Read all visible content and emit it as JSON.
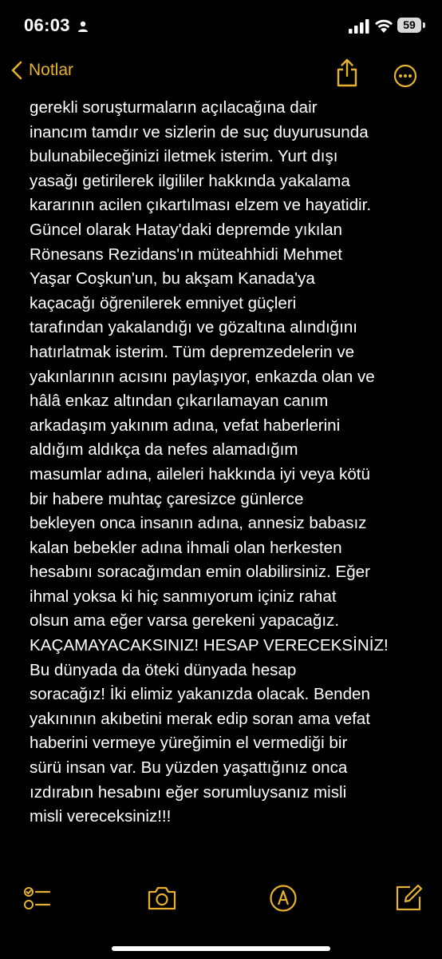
{
  "status_bar": {
    "time": "06:03",
    "battery_level": "59",
    "icons": [
      "person-icon",
      "cellular-signal-icon",
      "wifi-icon",
      "battery-icon"
    ]
  },
  "nav": {
    "back_label": "Notlar",
    "icons": [
      "chevron-left-icon",
      "share-icon",
      "more-icon"
    ]
  },
  "note": {
    "lines": [
      "gerekli soruşturmaların açılacağına dair",
      "inancım tamdır ve sizlerin de suç duyurusunda",
      "bulunabileceğinizi iletmek isterim. Yurt dışı",
      "yasağı getirilerek ilgililer hakkında yakalama",
      "kararının acilen çıkartılması elzem ve hayatidir.",
      "Güncel olarak Hatay'daki depremde yıkılan",
      "Rönesans Rezidans'ın müteahhidi Mehmet",
      "Yaşar Coşkun'un, bu akşam Kanada'ya",
      "kaçacağı öğrenilerek emniyet güçleri",
      "tarafından yakalandığı ve gözaltına alındığını",
      "hatırlatmak isterim. Tüm depremzedelerin ve",
      "yakınlarının acısını paylaşıyor, enkazda olan ve",
      "hâlâ enkaz altından çıkarılamayan canım",
      "arkadaşım yakınım adına, vefat haberlerini",
      "aldığım aldıkça  da nefes alamadığım",
      "masumlar adına, aileleri hakkında iyi veya kötü",
      "bir habere muhtaç çaresizce günlerce",
      "bekleyen onca insanın adına, annesiz babasız",
      "kalan bebekler adına ihmali olan herkesten",
      "hesabını soracağımdan emin olabilirsiniz. Eğer",
      "ihmal yoksa ki hiç sanmıyorum içiniz rahat",
      "olsun ama eğer varsa gerekeni yapacağız.",
      "KAÇAMAYACAKSINIZ! HESAP VERECEKSİNİZ!",
      "Bu dünyada da öteki dünyada hesap",
      "soracağız! İki elimiz yakanızda olacak. Benden",
      "yakınının akıbetini merak edip soran ama vefat",
      "haberini vermeye yüreğimin el vermediği bir",
      "sürü insan var. Bu yüzden yaşattığınız onca",
      "ızdırabın hesabını eğer sorumluysanız misli",
      "misli vereceksiniz!!!"
    ]
  },
  "toolbar": {
    "icons": [
      "checklist-icon",
      "camera-icon",
      "markup-pen-icon",
      "compose-icon"
    ]
  },
  "colors": {
    "accent": "#e6b22e",
    "background": "#000000",
    "text": "#ffffff"
  }
}
